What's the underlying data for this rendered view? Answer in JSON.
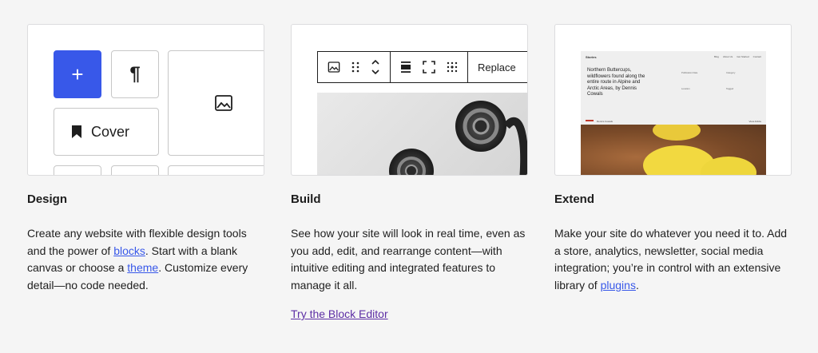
{
  "sections": [
    {
      "id": "design",
      "title": "Design",
      "text_parts": [
        "Create any website with flexible design tools and the power of ",
        "blocks",
        ". Start with a blank canvas or choose a ",
        "theme",
        ". Customize every detail—no code needed."
      ]
    },
    {
      "id": "build",
      "title": "Build",
      "text": "See how your site will look in real time, even as you add, edit, and rearrange content—with intuitive editing and integrated features to manage it all.",
      "link_label": "Try the Block Editor"
    },
    {
      "id": "extend",
      "title": "Extend",
      "text_parts": [
        "Make your site do whatever you need it to. Add a store, analytics, newsletter, social media integration; you’re in control with an extensive library of ",
        "plugins",
        "."
      ]
    }
  ],
  "design_card": {
    "plus_label": "+",
    "paragraph_label": "¶",
    "cover_label": "Cover",
    "icons": [
      "plus-icon",
      "pilcrow-icon",
      "image-icon",
      "bookmark-icon"
    ]
  },
  "build_card": {
    "replace_label": "Replace",
    "icons": [
      "image-icon",
      "drag-handle-icon",
      "move-updown-icon",
      "align-icon",
      "fullscreen-icon",
      "grid-dots-icon"
    ]
  },
  "extend_card": {
    "brand": "Stories",
    "nav": [
      "Blog",
      "About Us",
      "Get Started",
      "Contact"
    ],
    "headline": "Northern Buttercups, wildflowers found along the entire route in Alpine and Arctic Areas, by Dennis Cowals",
    "meta": [
      "Publication Date",
      "Location",
      "Tagged",
      "Category"
    ],
    "footer_left": "Dennis Cowals",
    "footer_right": "View Article"
  },
  "colors": {
    "background": "#f5f5f5",
    "accent_blue": "#3858e9",
    "visited_purple": "#5d2fa5",
    "text": "#1e1e1e"
  }
}
